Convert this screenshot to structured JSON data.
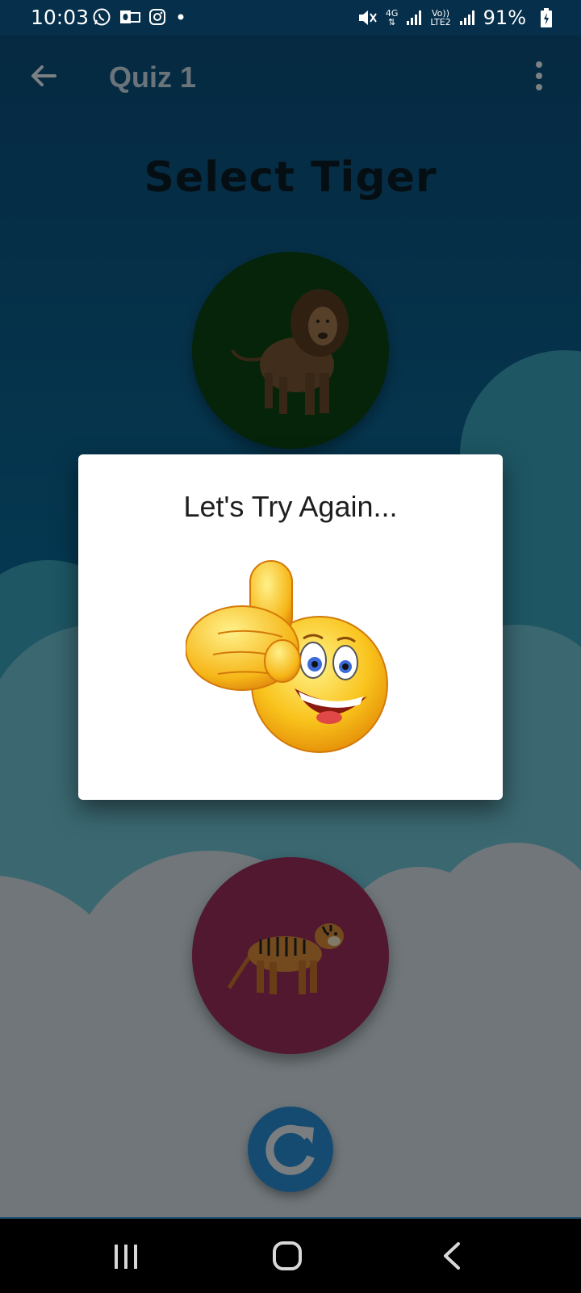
{
  "status_bar": {
    "time": "10:03",
    "network_top": "4G",
    "network_label": "Vo))",
    "network_sub": "LTE2",
    "battery": "91%",
    "icons": [
      "whatsapp-icon",
      "outlook-icon",
      "instagram-icon",
      "notification-dot-icon",
      "mute-icon",
      "signal-icon",
      "battery-charging-icon"
    ]
  },
  "app_bar": {
    "title": "Quiz 1",
    "back_icon": "arrow-left-icon",
    "menu_icon": "more-vert-icon"
  },
  "quiz": {
    "question": "Select Tiger",
    "options": [
      {
        "animal": "lion",
        "color": "#0d4412"
      },
      {
        "animal": "tiger",
        "color": "#9a2f5b"
      }
    ],
    "refresh_icon": "refresh-icon"
  },
  "dialog": {
    "title": "Let's Try Again...",
    "image": "thumbs-up-emoji"
  },
  "nav_bar": {
    "icons": [
      "recents-icon",
      "home-icon",
      "back-icon"
    ]
  }
}
